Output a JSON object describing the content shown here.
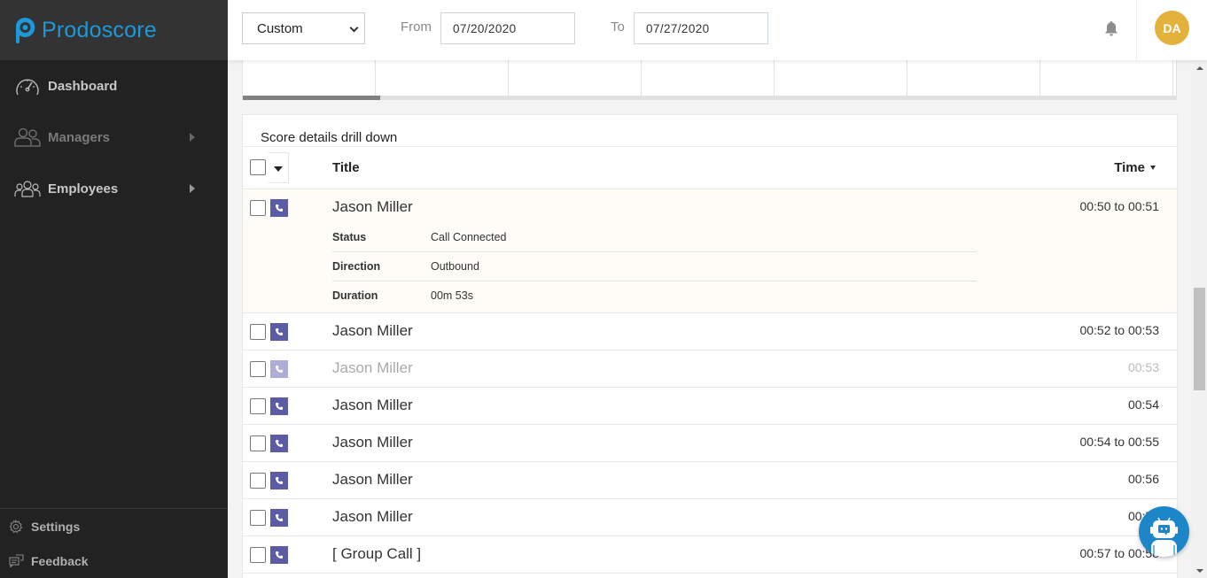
{
  "brand": {
    "name": "Prodoscore",
    "color": "#1e98d7"
  },
  "sidebar": {
    "items": [
      {
        "label": "Dashboard",
        "icon": "speedometer-icon",
        "has_submenu": false
      },
      {
        "label": "Managers",
        "icon": "managers-icon",
        "has_submenu": true
      },
      {
        "label": "Employees",
        "icon": "employees-icon",
        "has_submenu": true
      }
    ],
    "bottom": [
      {
        "label": "Settings",
        "icon": "gear-icon"
      },
      {
        "label": "Feedback",
        "icon": "feedback-icon"
      }
    ]
  },
  "topbar": {
    "range_select": "Custom",
    "from_label": "From",
    "from_value": "07/20/2020",
    "to_label": "To",
    "to_value": "07/27/2020",
    "avatar_initials": "DA",
    "avatar_color": "#e3b23c"
  },
  "drilldown": {
    "title": "Score details drill down",
    "columns": {
      "title": "Title",
      "time": "Time"
    },
    "rows": [
      {
        "name": "Jason Miller",
        "time": "00:50 to 00:51",
        "expanded": true,
        "faded": false,
        "details": [
          {
            "key": "Status",
            "value": "Call Connected"
          },
          {
            "key": "Direction",
            "value": "Outbound"
          },
          {
            "key": "Duration",
            "value": "00m 53s"
          }
        ]
      },
      {
        "name": "Jason Miller",
        "time": "00:52 to 00:53",
        "faded": false
      },
      {
        "name": "Jason Miller",
        "time": "00:53",
        "faded": true
      },
      {
        "name": "Jason Miller",
        "time": "00:54",
        "faded": false
      },
      {
        "name": "Jason Miller",
        "time": "00:54 to 00:55",
        "faded": false
      },
      {
        "name": "Jason Miller",
        "time": "00:56",
        "faded": false
      },
      {
        "name": "Jason Miller",
        "time": "00:57",
        "faded": false
      },
      {
        "name": "[ Group Call ]",
        "time": "00:57 to 00:58",
        "faded": false
      }
    ]
  },
  "colors": {
    "sidebar_bg": "#222222",
    "call_icon": "#5b5ba6",
    "chatbot": "#1d86c9"
  }
}
